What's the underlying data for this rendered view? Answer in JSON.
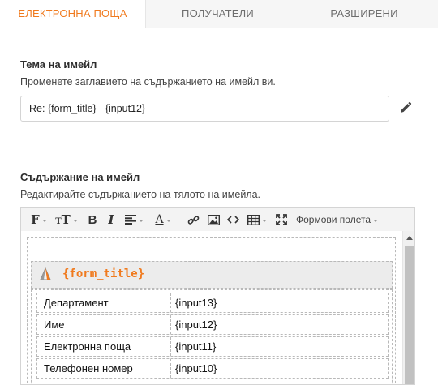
{
  "tabs": [
    {
      "label": "ЕЛЕКТРОННА ПОЩА",
      "active": true
    },
    {
      "label": "ПОЛУЧАТЕЛИ",
      "active": false
    },
    {
      "label": "РАЗШИРЕНИ",
      "active": false
    }
  ],
  "subject": {
    "title": "Тема на имейл",
    "description": "Променете заглавието на съдържанието на имейл ви.",
    "value": "Re: {form_title} - {input12}",
    "edit_icon": "pencil-icon"
  },
  "content": {
    "title": "Съдържание на имейл",
    "description": "Редактирайте съдържанието на тялото на имейла.",
    "toolbar": {
      "form_fields_label": "Формови полета",
      "icons": [
        "font-family-icon",
        "font-size-icon",
        "bold-icon",
        "italic-icon",
        "align-icon",
        "text-color-icon",
        "link-icon",
        "image-icon",
        "code-icon",
        "table-icon",
        "fullscreen-icon"
      ]
    },
    "form_title_placeholder": "{form_title}",
    "rows": [
      {
        "label": "Департамент",
        "value": "{input13}"
      },
      {
        "label": "Име",
        "value": "{input12}"
      },
      {
        "label": "Електронна поща",
        "value": "{input11}"
      },
      {
        "label": "Телефонен номер",
        "value": "{input10}"
      }
    ]
  },
  "colors": {
    "accent": "#f07a1e",
    "tab_bg": "#f6f6f6",
    "border": "#d4d4d4"
  }
}
